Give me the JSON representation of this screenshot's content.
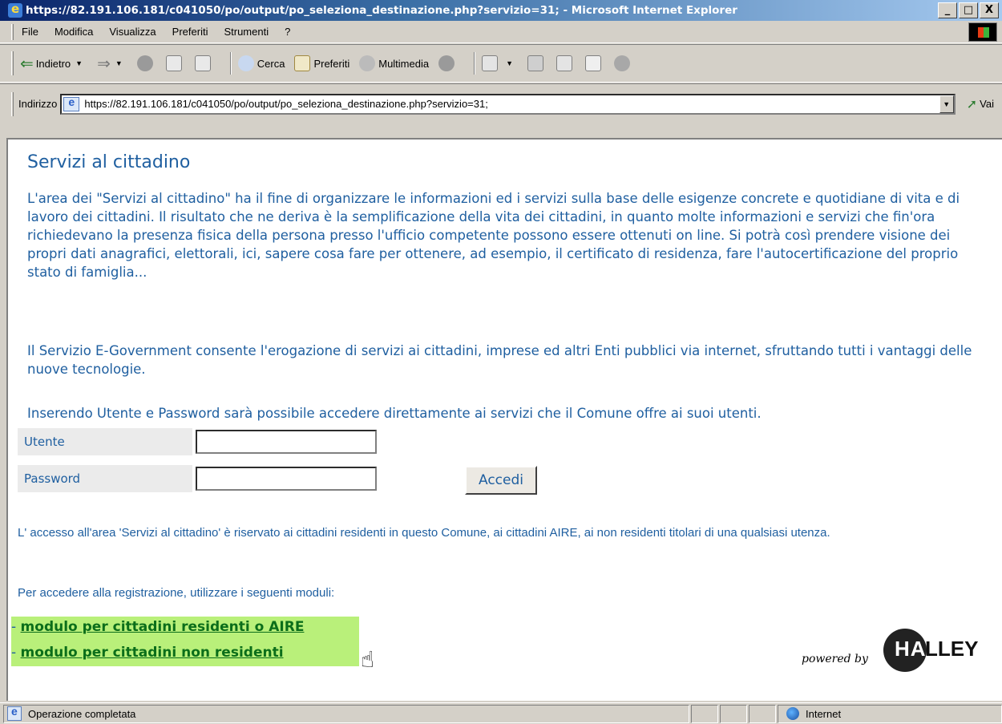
{
  "window": {
    "title": "https://82.191.106.181/c041050/po/output/po_seleziona_destinazione.php?servizio=31; - Microsoft Internet Explorer",
    "controls": [
      "_",
      "□",
      "X"
    ]
  },
  "menubar": {
    "items": [
      "File",
      "Modifica",
      "Visualizza",
      "Preferiti",
      "Strumenti",
      "?"
    ]
  },
  "toolbar": {
    "back_label": "Indietro",
    "search_label": "Cerca",
    "favorites_label": "Preferiti",
    "media_label": "Multimedia"
  },
  "addressbar": {
    "label": "Indirizzo",
    "url": "https://82.191.106.181/c041050/po/output/po_seleziona_destinazione.php?servizio=31;",
    "go_label": "Vai"
  },
  "page": {
    "title": "Servizi al cittadino",
    "intro": "L'area dei \"Servizi al cittadino\" ha il fine di organizzare le informazioni ed i servizi sulla base delle esigenze concrete e quotidiane di vita e di lavoro dei cittadini. Il risultato che ne deriva è la semplificazione della vita dei cittadini, in quanto molte informazioni e servizi che fin'ora richiedevano la presenza fisica della persona presso l'ufficio competente possono essere ottenuti on line. Si potrà così prendere visione dei propri dati anagrafici, elettorali, ici, sapere cosa fare per ottenere, ad esempio, il certificato di residenza, fare l'autocertificazione del proprio stato di famiglia...",
    "egov": "Il Servizio E-Government consente l'erogazione di servizi ai cittadini, imprese ed altri Enti pubblici via internet, sfruttando tutti i vantaggi delle nuove tecnologie.",
    "login_hint": "Inserendo Utente e Password sarà possibile accedere direttamente ai servizi che il Comune offre ai suoi utenti.",
    "user_label": "Utente",
    "password_label": "Password",
    "user_value": "",
    "password_value": "",
    "login_button": "Accedi",
    "access_note": "L' accesso all'area 'Servizi al cittadino' è riservato ai cittadini residenti in questo Comune, ai cittadini AIRE, ai non residenti titolari di una qualsiasi utenza.",
    "register_note": "Per accedere alla registrazione, utilizzare i seguenti moduli:",
    "link_prefix": "- ",
    "link_residents": "modulo per cittadini residenti o AIRE",
    "link_nonresidents": "modulo per cittadini non residenti",
    "powered_by": "powered by",
    "brand_logo_text": "HALLEY"
  },
  "statusbar": {
    "text": "Operazione completata",
    "zone": "Internet"
  }
}
